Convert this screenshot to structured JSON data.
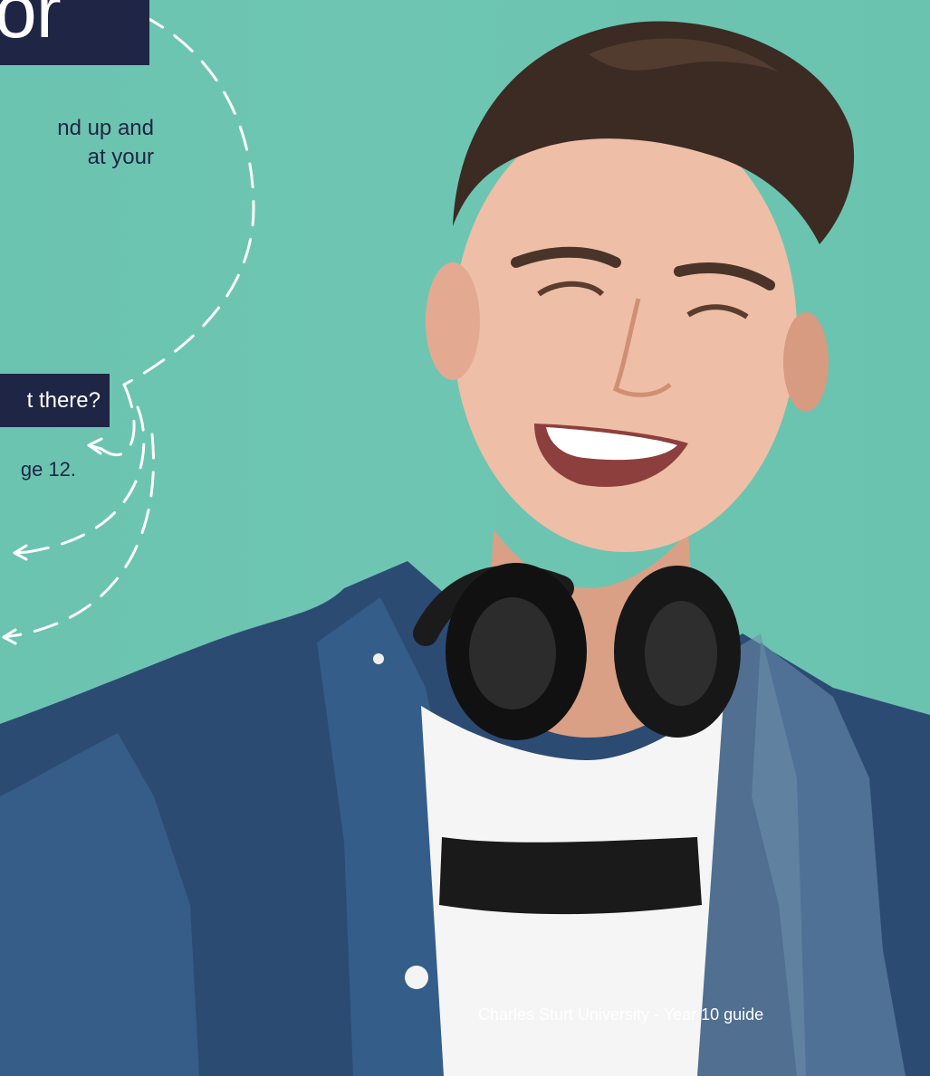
{
  "heading": {
    "visible_text": "or"
  },
  "intro": {
    "line1": "nd up and",
    "line2": "at your"
  },
  "question": {
    "label": "t there?"
  },
  "page_reference": {
    "label": "ge 12."
  },
  "footer": {
    "label": "Charles Sturt University - Year 10 guide"
  },
  "photo": {
    "subject": "smiling young man with dark hair wearing a denim shirt and black headphones around neck"
  },
  "colors": {
    "background": "#6cc4b0",
    "navy": "#1f2544",
    "white": "#ffffff"
  }
}
